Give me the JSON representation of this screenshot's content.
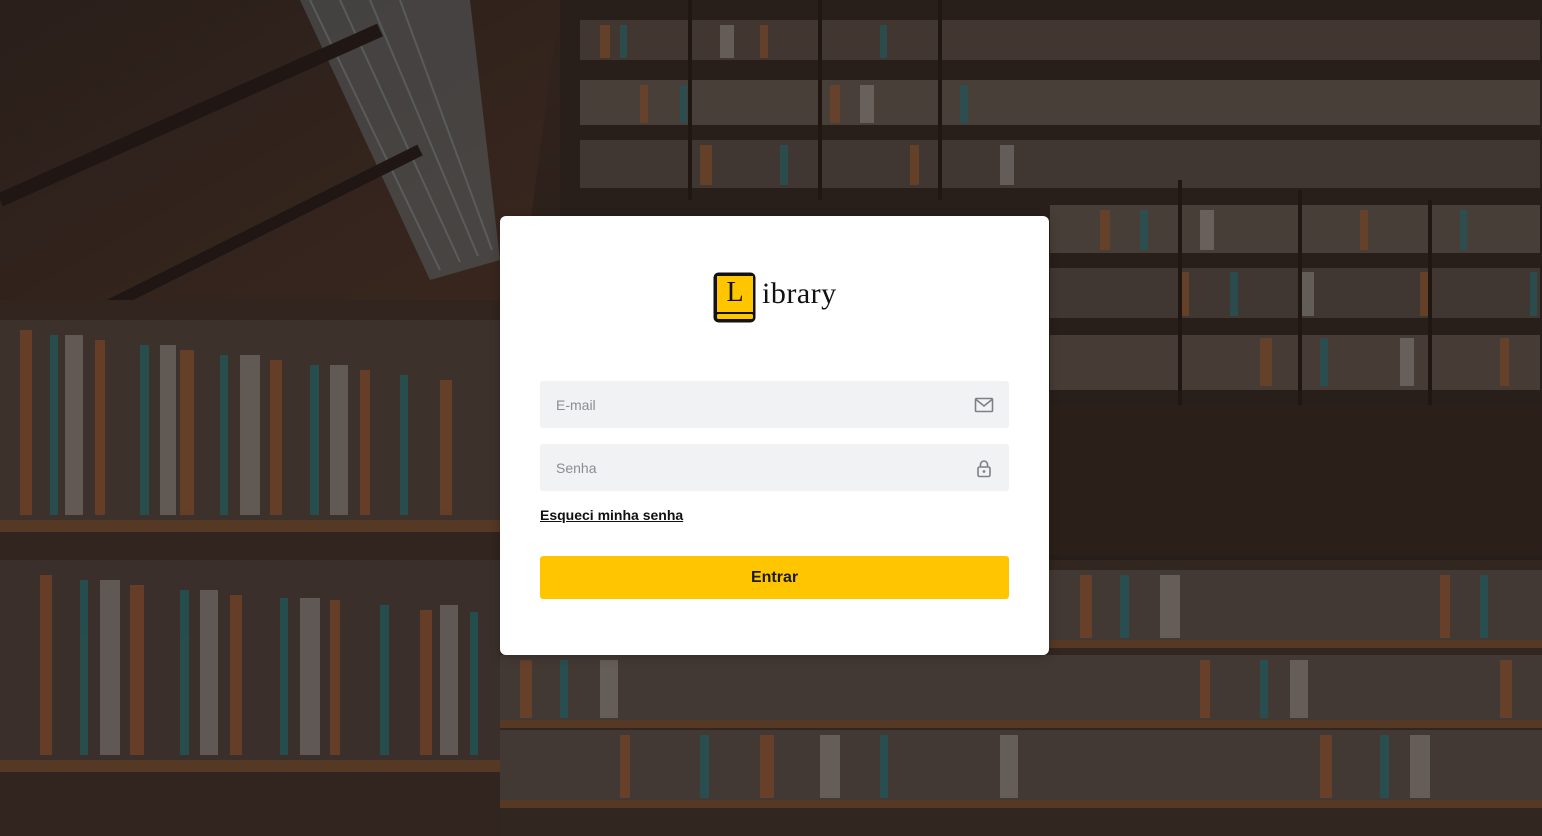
{
  "logo": {
    "letter": "L",
    "word": "ibrary",
    "brand_color": "#ffc600"
  },
  "login_form": {
    "email_placeholder": "E-mail",
    "email_icon": "mail-icon",
    "password_placeholder": "Senha",
    "password_icon": "lock-icon",
    "forgot_link": "Esqueci minha senha",
    "submit_label": "Entrar",
    "submit_color": "#ffc600"
  },
  "background": {
    "description_icon": "library-bookshelves-photo"
  }
}
